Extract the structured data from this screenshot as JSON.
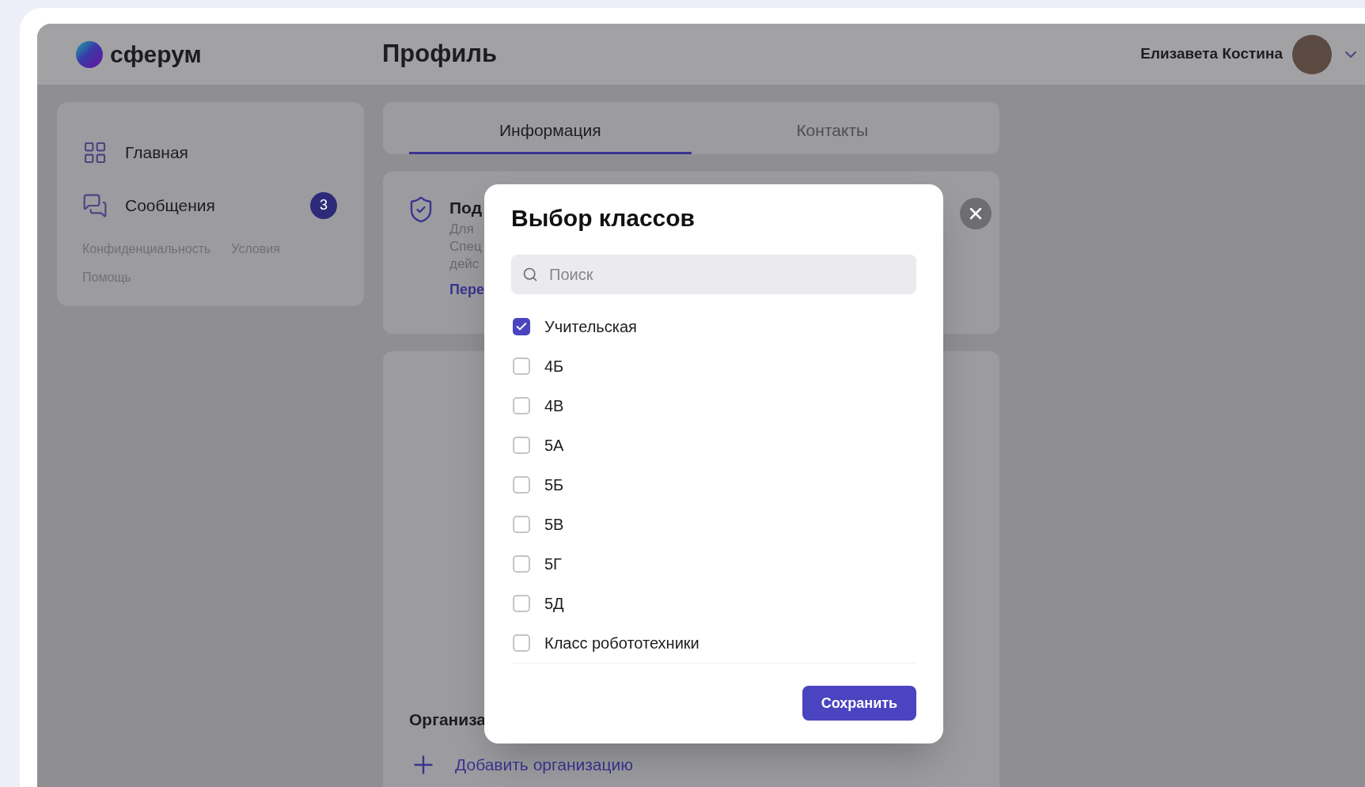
{
  "header": {
    "logo_text": "сферум",
    "page_title": "Профиль",
    "user_name": "Елизавета Костина"
  },
  "sidebar": {
    "items": [
      {
        "kind": "home",
        "label": "Главная"
      },
      {
        "kind": "messages",
        "label": "Сообщения",
        "badge": "3"
      }
    ],
    "links": [
      "Конфиденциальность",
      "Условия",
      "Помощь"
    ]
  },
  "tabs": [
    {
      "label": "Информация",
      "selected": true
    },
    {
      "label": "Контакты",
      "selected": false
    }
  ],
  "info_card": {
    "title": "Под",
    "lines": [
      "Для",
      "Спец",
      "дейс"
    ],
    "link": "Пере"
  },
  "organizations": {
    "title": "Организа",
    "add_label": "Добавить организацию"
  },
  "dialog": {
    "title": "Выбор классов",
    "search": {
      "placeholder": "Поиск"
    },
    "classes": [
      {
        "label": "Учительская",
        "checked": true
      },
      {
        "label": "4Б",
        "checked": false
      },
      {
        "label": "4В",
        "checked": false
      },
      {
        "label": "5А",
        "checked": false
      },
      {
        "label": "5Б",
        "checked": false
      },
      {
        "label": "5В",
        "checked": false
      },
      {
        "label": "5Г",
        "checked": false
      },
      {
        "label": "5Д",
        "checked": false
      },
      {
        "label": "Класс робототехники",
        "checked": false
      }
    ],
    "save_label": "Сохранить"
  }
}
